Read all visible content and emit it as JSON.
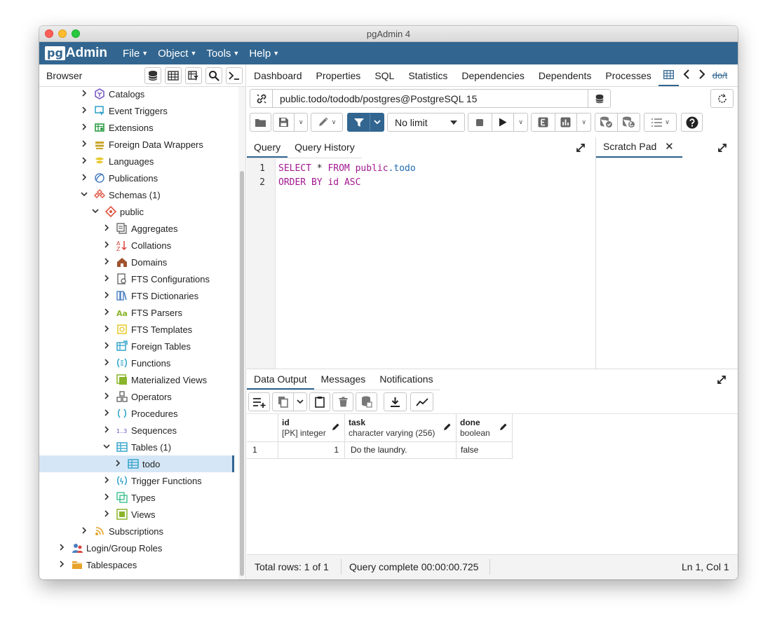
{
  "window": {
    "title": "pgAdmin 4"
  },
  "menubar": {
    "logo_pg": "pg",
    "logo_admin": "Admin",
    "items": [
      "File",
      "Object",
      "Tools",
      "Help"
    ]
  },
  "sidebar": {
    "title": "Browser",
    "tree": [
      {
        "label": "Catalogs",
        "icon": "catalogs-icon",
        "level": 3,
        "toggle": "collapsed",
        "color": "#7b5cc4"
      },
      {
        "label": "Event Triggers",
        "icon": "event-triggers-icon",
        "level": 3,
        "toggle": "collapsed",
        "color": "#2aa0c8"
      },
      {
        "label": "Extensions",
        "icon": "extensions-icon",
        "level": 3,
        "toggle": "collapsed",
        "color": "#2d9d44"
      },
      {
        "label": "Foreign Data Wrappers",
        "icon": "foreign-data-wrappers-icon",
        "level": 3,
        "toggle": "collapsed",
        "color": "#c9a52a"
      },
      {
        "label": "Languages",
        "icon": "languages-icon",
        "level": 3,
        "toggle": "collapsed",
        "color": "#e7c92a"
      },
      {
        "label": "Publications",
        "icon": "publications-icon",
        "level": 3,
        "toggle": "collapsed",
        "color": "#4a7fc1"
      },
      {
        "label": "Schemas (1)",
        "icon": "schemas-icon",
        "level": 3,
        "toggle": "expanded",
        "color": "#e0543f"
      },
      {
        "label": "public",
        "icon": "schema-icon",
        "level": 4,
        "toggle": "expanded",
        "color": "#e0543f"
      },
      {
        "label": "Aggregates",
        "icon": "aggregates-icon",
        "level": 5,
        "toggle": "collapsed",
        "color": "#6a6a6a"
      },
      {
        "label": "Collations",
        "icon": "collations-icon",
        "level": 5,
        "toggle": "collapsed",
        "color": "#d9443c"
      },
      {
        "label": "Domains",
        "icon": "domains-icon",
        "level": 5,
        "toggle": "collapsed",
        "color": "#a0522d"
      },
      {
        "label": "FTS Configurations",
        "icon": "fts-configurations-icon",
        "level": 5,
        "toggle": "collapsed",
        "color": "#6a6a6a"
      },
      {
        "label": "FTS Dictionaries",
        "icon": "fts-dictionaries-icon",
        "level": 5,
        "toggle": "collapsed",
        "color": "#4a7fc1"
      },
      {
        "label": "FTS Parsers",
        "icon": "fts-parsers-icon",
        "level": 5,
        "toggle": "collapsed",
        "color": "#8ab52a"
      },
      {
        "label": "FTS Templates",
        "icon": "fts-templates-icon",
        "level": 5,
        "toggle": "collapsed",
        "color": "#e7c92a"
      },
      {
        "label": "Foreign Tables",
        "icon": "foreign-tables-icon",
        "level": 5,
        "toggle": "collapsed",
        "color": "#2aa0c8"
      },
      {
        "label": "Functions",
        "icon": "functions-icon",
        "level": 5,
        "toggle": "collapsed",
        "color": "#2aa0c8"
      },
      {
        "label": "Materialized Views",
        "icon": "materialized-views-icon",
        "level": 5,
        "toggle": "collapsed",
        "color": "#8ab52a"
      },
      {
        "label": "Operators",
        "icon": "operators-icon",
        "level": 5,
        "toggle": "collapsed",
        "color": "#6a6a6a"
      },
      {
        "label": "Procedures",
        "icon": "procedures-icon",
        "level": 5,
        "toggle": "collapsed",
        "color": "#2aa0c8"
      },
      {
        "label": "Sequences",
        "icon": "sequences-icon",
        "level": 5,
        "toggle": "collapsed",
        "color": "#6b4cc4"
      },
      {
        "label": "Tables (1)",
        "icon": "tables-icon",
        "level": 5,
        "toggle": "expanded",
        "color": "#2aa0c8"
      },
      {
        "label": "todo",
        "icon": "table-icon",
        "level": 6,
        "toggle": "collapsed",
        "color": "#2aa0c8",
        "selected": true
      },
      {
        "label": "Trigger Functions",
        "icon": "trigger-functions-icon",
        "level": 5,
        "toggle": "collapsed",
        "color": "#2aa0c8"
      },
      {
        "label": "Types",
        "icon": "types-icon",
        "level": 5,
        "toggle": "collapsed",
        "color": "#3fbf8f"
      },
      {
        "label": "Views",
        "icon": "views-icon",
        "level": 5,
        "toggle": "collapsed",
        "color": "#8ab52a"
      },
      {
        "label": "Subscriptions",
        "icon": "subscriptions-icon",
        "level": 3,
        "toggle": "collapsed",
        "color": "#e7a32a"
      },
      {
        "label": "Login/Group Roles",
        "icon": "login-group-roles-icon",
        "level": 1,
        "toggle": "collapsed",
        "color": "#4a7fc1"
      },
      {
        "label": "Tablespaces",
        "icon": "tablespaces-icon",
        "level": 1,
        "toggle": "collapsed",
        "color": "#e7a32a"
      }
    ]
  },
  "main": {
    "tabs": [
      "Dashboard",
      "Properties",
      "SQL",
      "Statistics",
      "Dependencies",
      "Dependents",
      "Processes"
    ],
    "tab_partial": "do/t",
    "connection": "public.todo/tododb/postgres@PostgreSQL 15",
    "limit": "No limit",
    "query_tabs": [
      "Query",
      "Query History"
    ],
    "scratch_pad": "Scratch Pad",
    "code_lines": [
      {
        "n": "1",
        "parts": [
          {
            "t": "SELECT",
            "c": "kw"
          },
          {
            "t": " * ",
            "c": ""
          },
          {
            "t": "FROM",
            "c": "kw"
          },
          {
            "t": " ",
            "c": ""
          },
          {
            "t": "public",
            "c": "kw"
          },
          {
            "t": ".todo",
            "c": "id"
          }
        ]
      },
      {
        "n": "2",
        "parts": [
          {
            "t": "ORDER BY",
            "c": "kw"
          },
          {
            "t": " ",
            "c": ""
          },
          {
            "t": "id",
            "c": "kw"
          },
          {
            "t": " ",
            "c": ""
          },
          {
            "t": "ASC",
            "c": "kw"
          }
        ]
      }
    ],
    "result_tabs": [
      "Data Output",
      "Messages",
      "Notifications"
    ],
    "columns": [
      {
        "name": "id",
        "type": "[PK] integer"
      },
      {
        "name": "task",
        "type": "character varying (256)"
      },
      {
        "name": "done",
        "type": "boolean"
      }
    ],
    "rows": [
      {
        "num": "1",
        "cells": [
          "1",
          "Do the laundry.",
          "false"
        ]
      }
    ],
    "status": {
      "rows": "Total rows: 1 of 1",
      "query": "Query complete 00:00:00.725",
      "position": "Ln 1, Col 1"
    }
  },
  "colors": {
    "brand": "#326690",
    "selected_row": "#d5e7f7",
    "keyword": "#a0178f",
    "identifier": "#1b69b0"
  }
}
